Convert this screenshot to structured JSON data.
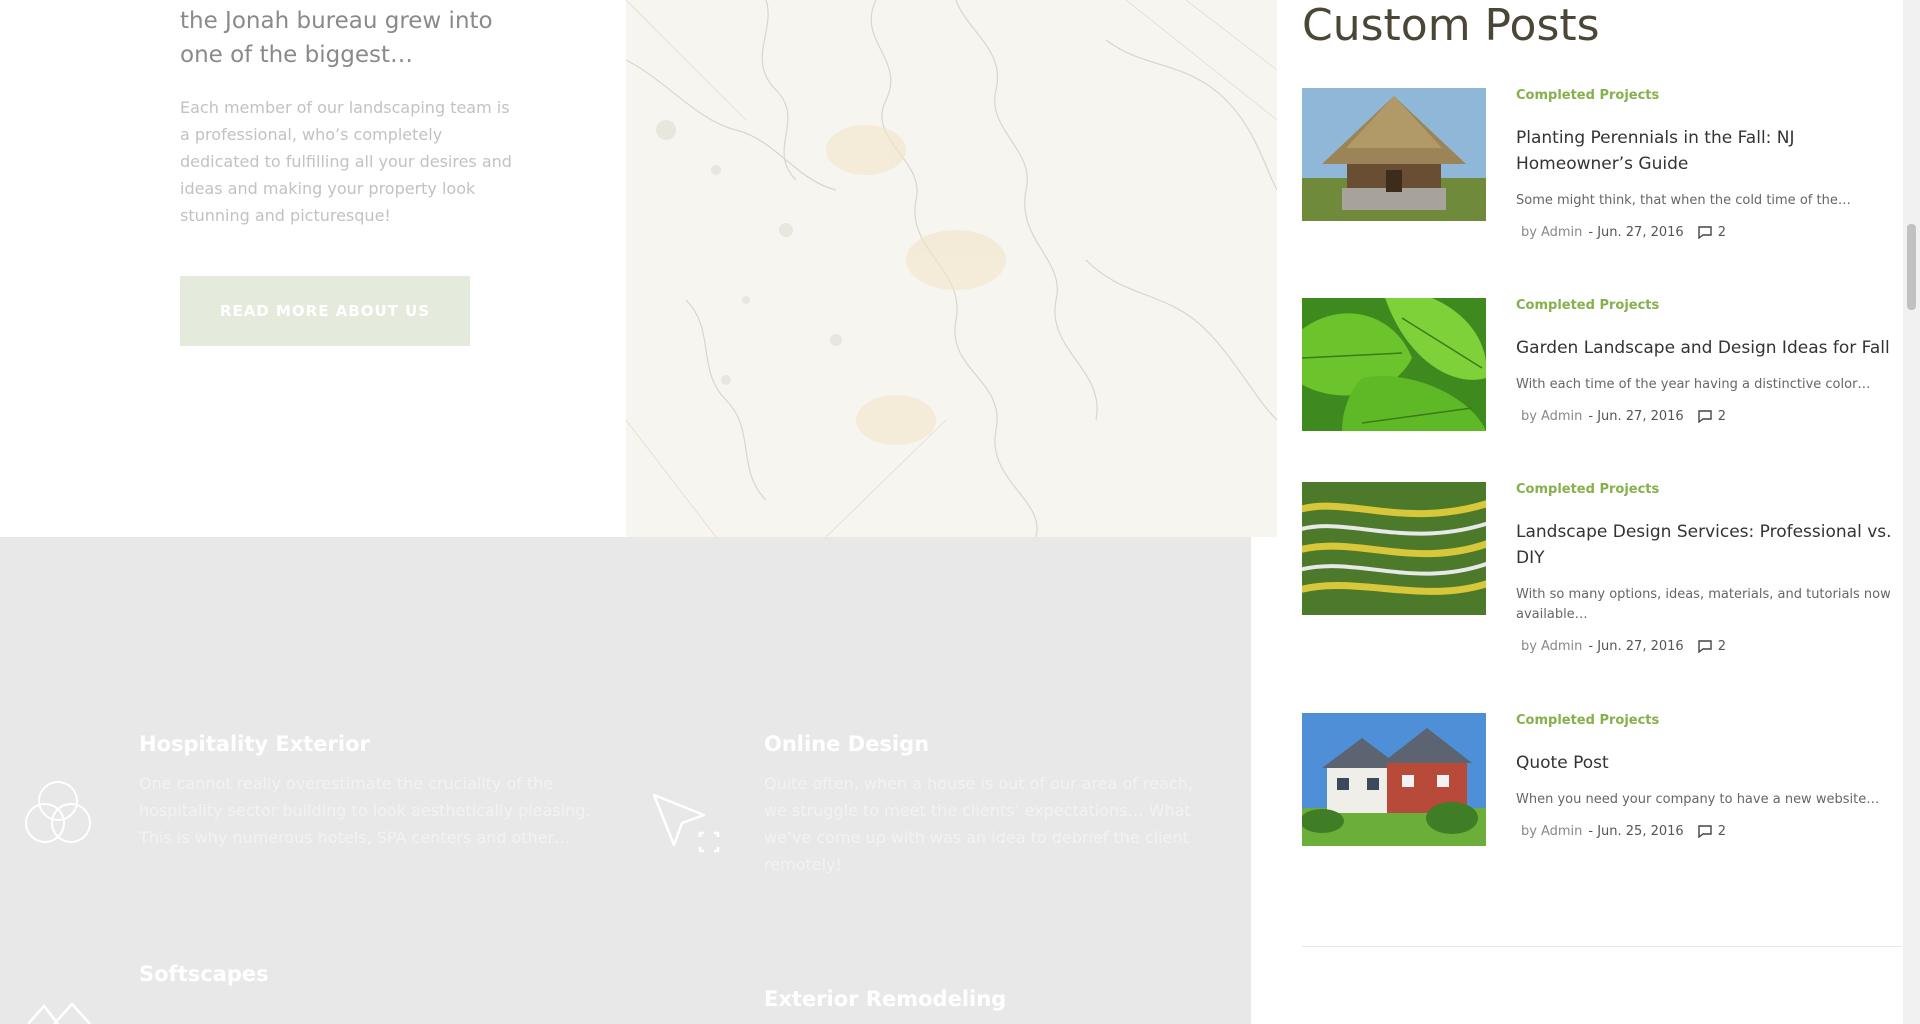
{
  "about": {
    "heading": "the Jonah bureau grew into one of the biggest…",
    "body": "Each member of our landscaping team is a professional, who’s completely dedicated to fulfilling all your desires and ideas and making your property look stunning and picturesque!",
    "button_label": "READ MORE ABOUT US"
  },
  "services": [
    {
      "title": "Hospitality Exterior",
      "description": "One cannot really overestimate the cruciality of the hospitality sector building to look aesthetically pleasing. This is why numerous hotels, SPA centers and other…",
      "icon": "circles-icon"
    },
    {
      "title": "Online Design",
      "description": "Quite often, when a house is out of our area of reach, we struggle to meet the clients’ expectations… What we’ve come up with was an idea to debrief the client remotely!",
      "icon": "cursor-icon"
    },
    {
      "title": "Softscapes",
      "description": "",
      "icon": "mountains-icon"
    },
    {
      "title": "Exterior Remodeling",
      "description": "",
      "icon": ""
    }
  ],
  "sidebar": {
    "title": "Custom Posts",
    "posts": [
      {
        "category": "Completed Projects",
        "title": "Planting Perennials in the Fall: NJ Homeowner’s Guide",
        "excerpt": "Some might think, that when the cold time of the…",
        "by": "by",
        "author": "Admin",
        "date": "- Jun. 27, 2016",
        "comments": "2",
        "thumb": "thatched-hut"
      },
      {
        "category": "Completed Projects",
        "title": "Garden Landscape and Design Ideas for Fall",
        "excerpt": "With each time of the year having a distinctive color…",
        "by": "by",
        "author": "Admin",
        "date": "- Jun. 27, 2016",
        "comments": "2",
        "thumb": "green-leaves"
      },
      {
        "category": "Completed Projects",
        "title": "Landscape Design Services: Professional vs. DIY",
        "excerpt": "With so many options, ideas, materials, and tutorials now available…",
        "by": "by",
        "author": "Admin",
        "date": "- Jun. 27, 2016",
        "comments": "2",
        "thumb": "hedge-maze"
      },
      {
        "category": "Completed Projects",
        "title": "Quote Post",
        "excerpt": "When you need your company to have a new website…",
        "by": "by",
        "author": "Admin",
        "date": "- Jun. 25, 2016",
        "comments": "2",
        "thumb": "suburban-house"
      }
    ]
  },
  "colors": {
    "accent": "#86b04c",
    "title": "#4b4636",
    "services_bg": "#e8e8e8"
  }
}
